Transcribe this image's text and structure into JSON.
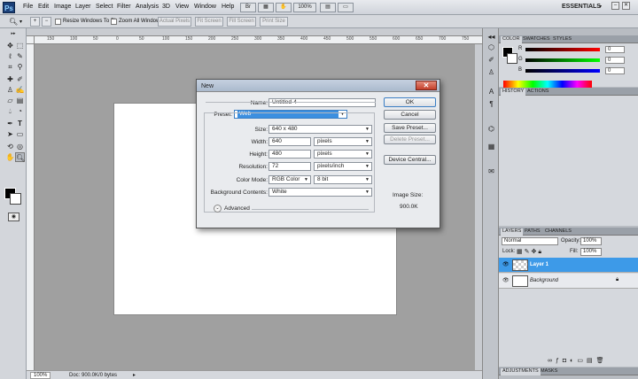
{
  "menubar": {
    "logo": "Ps",
    "items": [
      "File",
      "Edit",
      "Image",
      "Layer",
      "Select",
      "Filter",
      "Analysis",
      "3D",
      "View",
      "Window",
      "Help"
    ],
    "workspace": "ESSENTIALS",
    "zoom": "100%"
  },
  "options": {
    "resize_windows_label": "Resize Windows To Fit",
    "zoom_all_label": "Zoom All Windows",
    "actual_pixels": "Actual Pixels",
    "fit_screen": "Fit Screen",
    "fill_screen": "Fill Screen",
    "print_size": "Print Size"
  },
  "ruler": {
    "ticks": [
      "150",
      "100",
      "50",
      "0",
      "50",
      "100",
      "150",
      "200",
      "250",
      "300",
      "350",
      "400",
      "450",
      "500",
      "550",
      "600",
      "650",
      "700",
      "750"
    ]
  },
  "status": {
    "zoom": "100%",
    "doc": "Doc: 900.0K/0 bytes"
  },
  "color_panel": {
    "tabs": [
      "COLOR",
      "SWATCHES",
      "STYLES"
    ],
    "r_label": "R",
    "g_label": "G",
    "b_label": "B",
    "r": "0",
    "g": "0",
    "b": "0"
  },
  "history_panel": {
    "tabs": [
      "HISTORY",
      "ACTIONS"
    ]
  },
  "layers_panel": {
    "tabs": [
      "LAYERS",
      "PATHS",
      "CHANNELS"
    ],
    "blend_mode": "Normal",
    "opacity_label": "Opacity:",
    "opacity": "100%",
    "lock_label": "Lock:",
    "fill_label": "Fill:",
    "fill": "100%",
    "layers": [
      {
        "name": "Layer 1"
      },
      {
        "name": "Background"
      }
    ]
  },
  "adjustments_panel": {
    "tabs": [
      "ADJUSTMENTS",
      "MASKS"
    ]
  },
  "dialog": {
    "title": "New",
    "name_label": "Name:",
    "name_value": "Untitled-4",
    "preset_label": "Preset:",
    "preset_value": "Web",
    "size_label": "Size:",
    "size_value": "640 x 480",
    "width_label": "Width:",
    "width_value": "640",
    "width_unit": "pixels",
    "height_label": "Height:",
    "height_value": "480",
    "height_unit": "pixels",
    "resolution_label": "Resolution:",
    "resolution_value": "72",
    "resolution_unit": "pixels/inch",
    "color_mode_label": "Color Mode:",
    "color_mode_value": "RGB Color",
    "bit_depth": "8 bit",
    "bg_contents_label": "Background Contents:",
    "bg_contents_value": "White",
    "advanced_label": "Advanced",
    "ok": "OK",
    "cancel": "Cancel",
    "save_preset": "Save Preset...",
    "delete_preset": "Delete Preset...",
    "device_central": "Device Central...",
    "image_size_label": "Image Size:",
    "image_size_value": "900.0K"
  }
}
